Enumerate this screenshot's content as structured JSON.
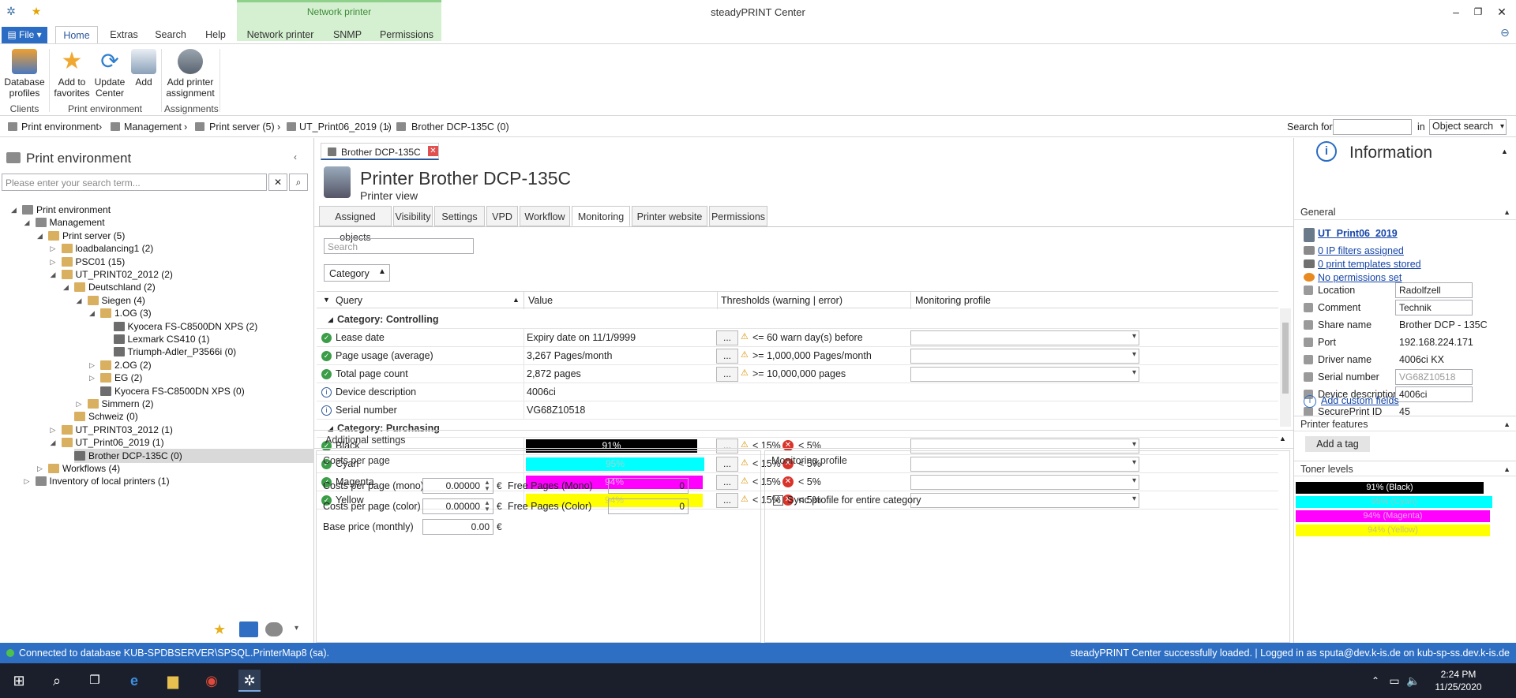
{
  "app": {
    "title": "steadyPRINT Center"
  },
  "quick_access": {
    "app_icon": "steadyprint-logo-icon",
    "favorites_icon": "star-icon"
  },
  "ribbon": {
    "file_label": "File",
    "tabs": [
      "Home",
      "Extras",
      "Search",
      "Help",
      "Network printer",
      "SNMP",
      "Permissions"
    ],
    "active_tab": "Home",
    "contextual_group": "Network printer",
    "buttons": [
      {
        "label": "Database profiles",
        "group": "Clients"
      },
      {
        "label": "Add to favorites",
        "group": "Print environment"
      },
      {
        "label": "Update Center",
        "group": "Print environment"
      },
      {
        "label": "Add",
        "group": "Print environment"
      },
      {
        "label": "Add printer assignment",
        "group": "Assignments"
      }
    ],
    "groups": [
      "Clients",
      "Print environment",
      "Assignments"
    ]
  },
  "breadcrumb": {
    "items": [
      "Print environment",
      "Management",
      "Print server (5)",
      "UT_Print06_2019 (1)",
      "Brother DCP-135C (0)"
    ],
    "search_label": "Search for",
    "search_value": "",
    "in_label": "in",
    "scope": "Object search"
  },
  "left_panel": {
    "title": "Print environment",
    "search_placeholder": "Please enter your search term...",
    "tree": [
      {
        "label": "Print environment",
        "level": 0,
        "expanded": true
      },
      {
        "label": "Management",
        "level": 1,
        "expanded": true
      },
      {
        "label": "Print server (5)",
        "level": 2,
        "expanded": true
      },
      {
        "label": "loadbalancing1 (2)",
        "level": 3,
        "expanded": false
      },
      {
        "label": "PSC01 (15)",
        "level": 3,
        "expanded": false
      },
      {
        "label": "UT_PRINT02_2012 (2)",
        "level": 3,
        "expanded": true
      },
      {
        "label": "Deutschland (2)",
        "level": 4,
        "expanded": true
      },
      {
        "label": "Siegen (4)",
        "level": 5,
        "expanded": true
      },
      {
        "label": "1.OG (3)",
        "level": 6,
        "expanded": true
      },
      {
        "label": "Kyocera FS-C8500DN XPS (2)",
        "level": 7
      },
      {
        "label": "Lexmark CS410 (1)",
        "level": 7
      },
      {
        "label": "Triumph-Adler_P3566i (0)",
        "level": 7
      },
      {
        "label": "2.OG (2)",
        "level": 6,
        "expanded": false
      },
      {
        "label": "EG (2)",
        "level": 6,
        "expanded": false
      },
      {
        "label": "Kyocera FS-C8500DN XPS (0)",
        "level": 6
      },
      {
        "label": "Simmern (2)",
        "level": 5,
        "expanded": false
      },
      {
        "label": "Schweiz (0)",
        "level": 4
      },
      {
        "label": "UT_PRINT03_2012 (1)",
        "level": 3,
        "expanded": false
      },
      {
        "label": "UT_Print06_2019 (1)",
        "level": 3,
        "expanded": true
      },
      {
        "label": "Brother DCP-135C (0)",
        "level": 4,
        "selected": true
      },
      {
        "label": "Workflows (4)",
        "level": 2,
        "expanded": false
      },
      {
        "label": "Inventory of local printers (1)",
        "level": 1,
        "expanded": false
      }
    ]
  },
  "doc_tab": {
    "label": "Brother DCP-135C"
  },
  "printer_header": {
    "title": "Printer Brother DCP-135C",
    "subtitle": "Printer view"
  },
  "sub_tabs": [
    "Assigned objects",
    "Visibility",
    "Settings",
    "VPD",
    "Workflow",
    "Monitoring",
    "Printer website",
    "Permissions"
  ],
  "active_sub_tab": "Monitoring",
  "monitoring": {
    "search_placeholder": "Search",
    "group_by": "Category",
    "columns": [
      "Query",
      "Value",
      "Thresholds (warning | error)",
      "Monitoring profile"
    ],
    "categories": [
      {
        "name": "Category: Controlling",
        "rows": [
          {
            "status": "ok",
            "query": "Lease date",
            "value": "Expiry date on 11/1/9999",
            "warning": "<= 60 warn day(s) before",
            "error": "",
            "has_profile": true
          },
          {
            "status": "ok",
            "query": "Page usage (average)",
            "value": "3,267 Pages/month",
            "warning": ">= 1,000,000 Pages/month",
            "error": "",
            "has_profile": true
          },
          {
            "status": "ok",
            "query": "Total page count",
            "value": "2,872 pages",
            "warning": ">= 10,000,000 pages",
            "error": "",
            "has_profile": true
          },
          {
            "status": "info",
            "query": "Device description",
            "value": "4006ci",
            "warning": "",
            "error": "",
            "has_profile": false
          },
          {
            "status": "info",
            "query": "Serial number",
            "value": "VG68Z10518",
            "warning": "",
            "error": "",
            "has_profile": false
          }
        ]
      },
      {
        "name": "Category: Purchasing",
        "rows": [
          {
            "status": "ok",
            "query": "Black",
            "bar_label": "91%",
            "level": 0.91,
            "color": "#000000",
            "text_color": "#ffffff",
            "warning": "< 15%",
            "error": "< 5%",
            "has_profile": true
          },
          {
            "status": "ok",
            "query": "Cyan",
            "bar_label": "95%",
            "level": 0.95,
            "color": "#00ffff",
            "text_color": "#9ad4d4",
            "warning": "< 15%",
            "error": "< 5%",
            "has_profile": true
          },
          {
            "status": "ok",
            "query": "Magenta",
            "bar_label": "94%",
            "level": 0.94,
            "color": "#ff00ff",
            "text_color": "#f6a0f6",
            "warning": "< 15%",
            "error": "< 5%",
            "has_profile": true
          },
          {
            "status": "ok",
            "query": "Yellow",
            "bar_label": "94%",
            "level": 0.94,
            "color": "#ffff00",
            "text_color": "#d4d46a",
            "warning": "< 15%",
            "error": "< 5%",
            "has_profile": true
          }
        ]
      }
    ]
  },
  "additional": {
    "title": "Additional settings",
    "costs_title": "Costs per page",
    "fields": [
      {
        "label": "Costs per page (mono)",
        "value": "0.00000",
        "unit": "€"
      },
      {
        "label": "Costs per page (color)",
        "value": "0.00000",
        "unit": "€"
      },
      {
        "label": "Base price (monthly)",
        "value": "0.00",
        "unit": "€"
      }
    ],
    "free_pages": [
      {
        "label": "Free Pages (Mono)",
        "value": "0"
      },
      {
        "label": "Free Pages (Color)",
        "value": "0"
      }
    ],
    "monitoring_profile_title": "Monitoring profile",
    "sync_label": "Sync profile for entire category",
    "sync_checked": true
  },
  "info_panel": {
    "title": "Information",
    "general_label": "General",
    "server_link": "UT_Print06_2019",
    "links": [
      "0 IP filters assigned",
      "0 print templates stored",
      "No permissions set"
    ],
    "fields": [
      {
        "label": "Location",
        "value": "Radolfzell",
        "input": true
      },
      {
        "label": "Comment",
        "value": "Technik",
        "input": true
      },
      {
        "label": "Share name",
        "value": "Brother DCP - 135C",
        "input": false
      },
      {
        "label": "Port",
        "value": "192.168.224.171",
        "input": false
      },
      {
        "label": "Driver name",
        "value": "4006ci KX",
        "input": false
      },
      {
        "label": "Serial number",
        "value": "VG68Z10518",
        "input": true,
        "disabled": true
      },
      {
        "label": "Device description",
        "value": "4006ci",
        "input": true
      },
      {
        "label": "SecurePrint ID",
        "value": "45",
        "input": false
      }
    ],
    "custom_fields_link": "Add custom fields",
    "features_label": "Printer features",
    "add_tag": "Add a tag",
    "toner_label": "Toner levels",
    "toner": [
      {
        "label": "91% (Black)",
        "level": 0.91,
        "color": "#000000",
        "text_color": "#ffffff"
      },
      {
        "label": "95% (Cyan)",
        "level": 0.95,
        "color": "#00ffff",
        "text_color": "#8ccaca"
      },
      {
        "label": "94% (Magenta)",
        "level": 0.94,
        "color": "#ff00ff",
        "text_color": "#f3a8f3"
      },
      {
        "label": "94% (Yellow)",
        "level": 0.94,
        "color": "#ffff00",
        "text_color": "#c8c878"
      }
    ]
  },
  "status_bar": {
    "left": "Connected to database KUB-SPDBSERVER\\SPSQL.PrinterMap8 (sa).",
    "right": "steadyPRINT Center successfully loaded. | Logged in as sputa@dev.k-is.de on kub-sp-ss.dev.k-is.de"
  },
  "taskbar": {
    "time": "2:24 PM",
    "date": "11/25/2020"
  }
}
